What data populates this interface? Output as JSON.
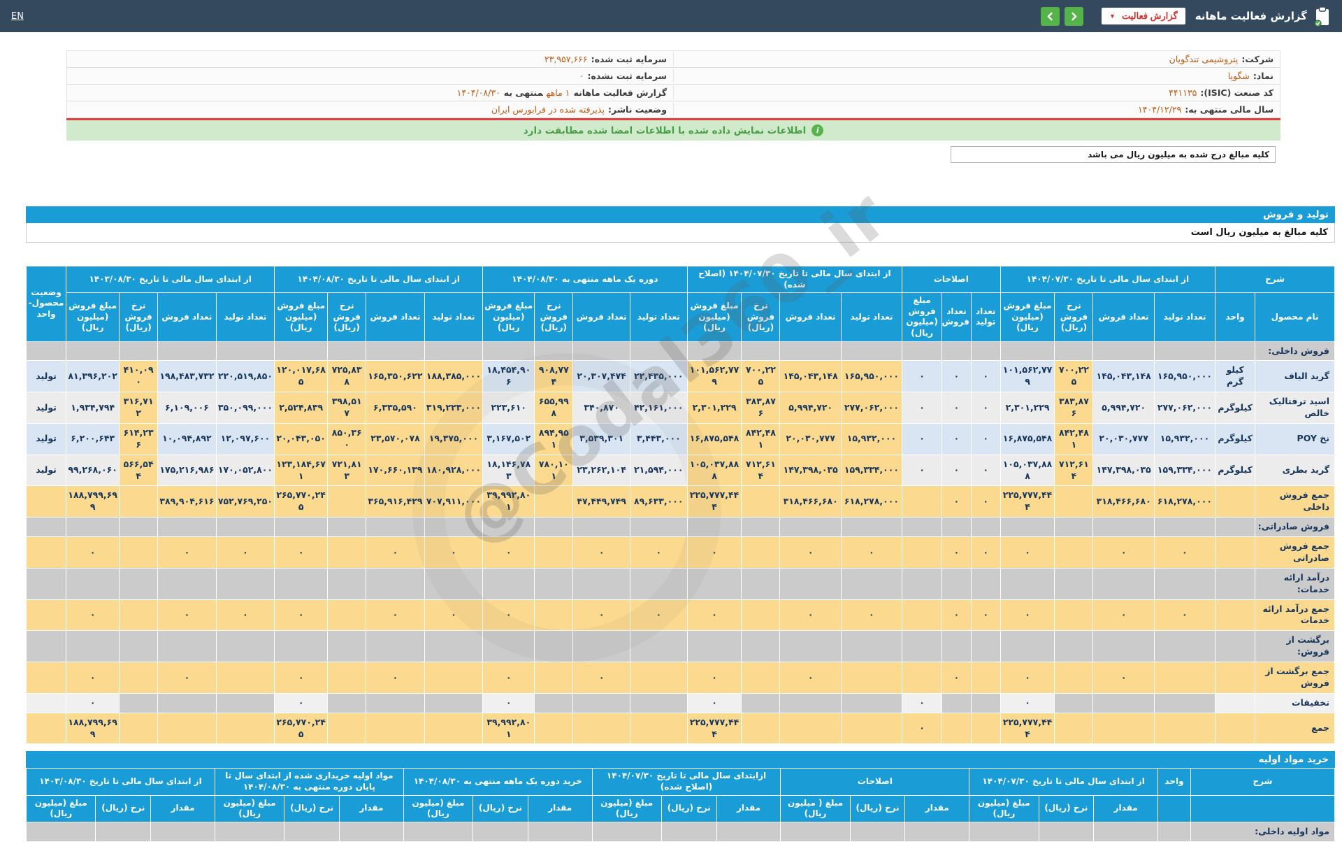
{
  "navbar": {
    "title": "گزارش فعالیت ماهانه",
    "dropdown_label": "گزارش فعالیت",
    "lang": "EN"
  },
  "company_info": {
    "right_rows": [
      {
        "label": "شرکت:",
        "value": "پتروشیمی تندگویان"
      },
      {
        "label": "نماد:",
        "value": "شگویا"
      },
      {
        "label": "کد صنعت (ISIC):",
        "value": "۴۴۱۱۳۵"
      },
      {
        "label": "سال مالی منتهی به:",
        "value": "۱۴۰۴/۱۲/۲۹"
      }
    ],
    "left_rows": [
      {
        "label": "سرمایه ثبت شده:",
        "value": "۲۳,۹۵۷,۶۶۶"
      },
      {
        "label": "سرمایه ثبت نشده:",
        "value": "۰"
      },
      {
        "label": "گزارش فعالیت ماهانه",
        "value": "۱ ماهه",
        "label2": "منتهی به",
        "value2": "۱۴۰۴/۰۸/۳۰"
      },
      {
        "label": "وضعیت ناشر:",
        "value": "پذیرفته شده در فرابورس ایران"
      }
    ]
  },
  "notice": {
    "signed_match": "اطلاعات نمایش داده شده با اطلاعات امضا شده مطابقت دارد",
    "amounts_note": "کلیه مبالغ درج شده به میلیون ریال می باشد"
  },
  "watermark": "@Codal360_ir",
  "production_sales": {
    "section_title": "تولید و فروش",
    "unit_note": "کلیه مبالغ به میلیون ریال است",
    "header_groups": [
      {
        "label": "شرح",
        "cols": [
          "نام محصول",
          "واحد"
        ]
      },
      {
        "label": "از ابتدای سال مالی تا تاریخ ۱۴۰۴/۰۷/۳۰",
        "cols": [
          "تعداد تولید",
          "تعداد فروش",
          "نرخ فروش (ریال)",
          "مبلغ فروش (میلیون ریال)"
        ]
      },
      {
        "label": "اصلاحات",
        "cols": [
          "تعداد تولید",
          "تعداد فروش",
          "مبلغ فروش (میلیون ریال)"
        ]
      },
      {
        "label": "از ابتدای سال مالی تا تاریخ ۱۴۰۴/۰۷/۳۰ (اصلاح شده)",
        "cols": [
          "تعداد تولید",
          "تعداد فروش",
          "نرخ فروش (ریال)",
          "مبلغ فروش (میلیون ریال)"
        ]
      },
      {
        "label": "دوره یک ماهه منتهی به ۱۴۰۴/۰۸/۳۰",
        "cols": [
          "تعداد تولید",
          "تعداد فروش",
          "نرخ فروش (ریال)",
          "مبلغ فروش (میلیون ریال)"
        ]
      },
      {
        "label": "از ابتدای سال مالی تا تاریخ ۱۴۰۴/۰۸/۳۰",
        "cols": [
          "تعداد تولید",
          "تعداد فروش",
          "نرخ فروش (ریال)",
          "مبلغ فروش (میلیون ریال)"
        ]
      },
      {
        "label": "از ابتدای سال مالی تا تاریخ ۱۴۰۳/۰۸/۳۰",
        "cols": [
          "تعداد تولید",
          "تعداد فروش",
          "نرخ فروش (ریال)",
          "مبلغ فروش (میلیون ریال)"
        ]
      },
      {
        "label": "وضعیت محصول- واحد",
        "cols": []
      }
    ],
    "rows": [
      {
        "type": "section",
        "label": "فروش داخلی:"
      },
      {
        "type": "data",
        "name": "گرید الیاف",
        "unit": "کیلو گرم",
        "status": "تولید",
        "cells": [
          "۱۶۵,۹۵۰,۰۰۰",
          "۱۴۵,۰۴۳,۱۴۸",
          "۷۰۰,۲۲۵",
          "۱۰۱,۵۶۲,۷۷۹",
          "۰",
          "۰",
          "۰",
          "۱۶۵,۹۵۰,۰۰۰",
          "۱۴۵,۰۴۳,۱۴۸",
          "۷۰۰,۲۲۵",
          "۱۰۱,۵۶۲,۷۷۹",
          "۲۲,۴۳۵,۰۰۰",
          "۲۰,۳۰۷,۴۷۴",
          "۹۰۸,۷۷۴",
          "۱۸,۴۵۴,۹۰۶",
          "۱۸۸,۳۸۵,۰۰۰",
          "۱۶۵,۳۵۰,۶۲۲",
          "۷۲۵,۸۳۸",
          "۱۲۰,۰۱۷,۶۸۵",
          "۲۲۰,۵۱۹,۸۵۰",
          "۱۹۸,۴۸۳,۷۳۲",
          "۴۱۰,۰۹۰",
          "۸۱,۳۹۶,۲۰۲"
        ]
      },
      {
        "type": "data",
        "name": "اسید ترفتالیک خالص",
        "unit": "کیلوگرم",
        "status": "تولید",
        "cells": [
          "۲۷۷,۰۶۲,۰۰۰",
          "۵,۹۹۴,۷۲۰",
          "۳۸۳,۸۷۶",
          "۲,۳۰۱,۲۲۹",
          "۰",
          "۰",
          "۰",
          "۲۷۷,۰۶۲,۰۰۰",
          "۵,۹۹۴,۷۲۰",
          "۳۸۳,۸۷۶",
          "۲,۳۰۱,۲۲۹",
          "۴۲,۱۶۱,۰۰۰",
          "۳۴۰,۸۷۰",
          "۶۵۵,۹۹۸",
          "۲۲۳,۶۱۰",
          "۳۱۹,۲۲۳,۰۰۰",
          "۶,۳۳۵,۵۹۰",
          "۳۹۸,۵۱۷",
          "۲,۵۲۴,۸۳۹",
          "۳۵۰,۰۹۹,۰۰۰",
          "۶,۱۰۹,۰۰۶",
          "۳۱۶,۷۱۲",
          "۱,۹۳۴,۷۹۴"
        ]
      },
      {
        "type": "data",
        "name": "نخ POY",
        "unit": "کیلوگرم",
        "status": "تولید",
        "cells": [
          "۱۵,۹۳۲,۰۰۰",
          "۲۰,۰۳۰,۷۷۷",
          "۸۴۲,۴۸۱",
          "۱۶,۸۷۵,۵۴۸",
          "۰",
          "۰",
          "۰",
          "۱۵,۹۳۲,۰۰۰",
          "۲۰,۰۳۰,۷۷۷",
          "۸۴۲,۴۸۱",
          "۱۶,۸۷۵,۵۴۸",
          "۳,۴۴۳,۰۰۰",
          "۳,۵۳۹,۳۰۱",
          "۸۹۴,۹۵۱",
          "۳,۱۶۷,۵۰۲",
          "۱۹,۳۷۵,۰۰۰",
          "۲۳,۵۷۰,۰۷۸",
          "۸۵۰,۳۶۰",
          "۲۰,۰۴۳,۰۵۰",
          "۱۲,۰۹۷,۶۰۰",
          "۱۰,۰۹۴,۸۹۲",
          "۶۱۴,۲۳۶",
          "۶,۲۰۰,۶۴۳"
        ]
      },
      {
        "type": "data",
        "name": "گرید بطری",
        "unit": "کیلوگرم",
        "status": "تولید",
        "cells": [
          "۱۵۹,۳۳۴,۰۰۰",
          "۱۴۷,۳۹۸,۰۳۵",
          "۷۱۲,۶۱۴",
          "۱۰۵,۰۳۷,۸۸۸",
          "۰",
          "۰",
          "۰",
          "۱۵۹,۳۳۴,۰۰۰",
          "۱۴۷,۳۹۸,۰۳۵",
          "۷۱۲,۶۱۴",
          "۱۰۵,۰۳۷,۸۸۸",
          "۲۱,۵۹۴,۰۰۰",
          "۲۳,۲۶۲,۱۰۴",
          "۷۸۰,۱۰۱",
          "۱۸,۱۴۶,۷۸۳",
          "۱۸۰,۹۲۸,۰۰۰",
          "۱۷۰,۶۶۰,۱۳۹",
          "۷۲۱,۸۱۳",
          "۱۲۳,۱۸۴,۶۷۱",
          "۱۷۰,۰۵۲,۸۰۰",
          "۱۷۵,۲۱۶,۹۸۶",
          "۵۶۶,۵۴۴",
          "۹۹,۲۶۸,۰۶۰"
        ]
      },
      {
        "type": "total",
        "label": "جمع فروش داخلی",
        "cells": [
          "۶۱۸,۲۷۸,۰۰۰",
          "۳۱۸,۴۶۶,۶۸۰",
          "",
          "۲۲۵,۷۷۷,۴۴۴",
          "۰",
          "۰",
          "",
          "۶۱۸,۲۷۸,۰۰۰",
          "۳۱۸,۴۶۶,۶۸۰",
          "",
          "۲۲۵,۷۷۷,۴۴۴",
          "۸۹,۶۳۳,۰۰۰",
          "۴۷,۴۴۹,۷۴۹",
          "",
          "۳۹,۹۹۲,۸۰۱",
          "۷۰۷,۹۱۱,۰۰۰",
          "۳۶۵,۹۱۶,۴۲۹",
          "",
          "۲۶۵,۷۷۰,۲۴۵",
          "۷۵۲,۷۶۹,۲۵۰",
          "۳۸۹,۹۰۴,۶۱۶",
          "",
          "۱۸۸,۷۹۹,۶۹۹"
        ]
      },
      {
        "type": "section",
        "label": "فروش صادراتی:"
      },
      {
        "type": "total",
        "label": "جمع فروش صادراتی",
        "cells": [
          "۰",
          "۰",
          "",
          "۰",
          "۰",
          "۰",
          "",
          "۰",
          "۰",
          "",
          "۰",
          "۰",
          "۰",
          "",
          "۰",
          "۰",
          "۰",
          "",
          "۰",
          "۰",
          "۰",
          "",
          "۰"
        ]
      },
      {
        "type": "section",
        "label": "درآمد ارائه خدمات:"
      },
      {
        "type": "total",
        "label": "جمع درآمد ارائه خدمات",
        "cells": [
          "۰",
          "۰",
          "",
          "۰",
          "۰",
          "۰",
          "",
          "۰",
          "۰",
          "",
          "۰",
          "۰",
          "۰",
          "",
          "۰",
          "۰",
          "۰",
          "",
          "۰",
          "۰",
          "۰",
          "",
          "۰"
        ]
      },
      {
        "type": "section",
        "label": "برگشت از فروش:"
      },
      {
        "type": "total",
        "label": "جمع برگشت از فروش",
        "cells": [
          "",
          "۰",
          "",
          "۰",
          "",
          "۰",
          "",
          "",
          "۰",
          "",
          "۰",
          "",
          "۰",
          "",
          "۰",
          "",
          "۰",
          "",
          "۰",
          "",
          "۰",
          "",
          "۰"
        ]
      },
      {
        "type": "discount",
        "label": "تخفیفات",
        "cells": [
          "",
          "",
          "",
          "۰",
          "",
          "",
          "۰",
          "",
          "",
          "",
          "۰",
          "",
          "",
          "",
          "۰",
          "",
          "",
          "",
          "۰",
          "",
          "",
          "",
          "۰"
        ]
      },
      {
        "type": "total",
        "label": "جمع",
        "cells": [
          "",
          "",
          "",
          "۲۲۵,۷۷۷,۴۴۴",
          "",
          "",
          "۰",
          "",
          "",
          "",
          "۲۲۵,۷۷۷,۴۴۴",
          "",
          "",
          "",
          "۳۹,۹۹۲,۸۰۱",
          "",
          "",
          "",
          "۲۶۵,۷۷۰,۲۴۵",
          "",
          "",
          "",
          "۱۸۸,۷۹۹,۶۹۹"
        ]
      }
    ]
  },
  "raw_materials": {
    "section_title": "خرید مواد اولیه",
    "header_groups": [
      {
        "label": "شرح",
        "cols": [
          ""
        ]
      },
      {
        "label": "واحد",
        "cols": [
          ""
        ]
      },
      {
        "label": "از ابتدای سال مالی تا تاریخ ۱۴۰۴/۰۷/۳۰",
        "cols": [
          "مقدار",
          "نرخ (ریال)",
          "مبلغ (میلیون ریال)"
        ]
      },
      {
        "label": "اصلاحات",
        "cols": [
          "مقدار",
          "نرخ (ریال)",
          "مبلغ ( میلیون ریال)"
        ]
      },
      {
        "label": "ازابتدای سال مالی تا تاریخ ۱۴۰۴/۰۷/۳۰ (اصلاح شده)",
        "cols": [
          "مقدار",
          "نرخ (ریال)",
          "مبلغ (میلیون ریال)"
        ]
      },
      {
        "label": "خرید دوره یک ماهه منتهی به ۱۴۰۴/۰۸/۳۰",
        "cols": [
          "مقدار",
          "نرخ (ریال)",
          "مبلغ (میلیون ریال)"
        ]
      },
      {
        "label": "مواد اولیه خریداری شده از ابتدای سال تا پایان دوره منتهی به ۱۴۰۴/۰۸/۳۰",
        "cols": [
          "مقدار",
          "نرخ (ریال)",
          "مبلغ (میلیون ریال)"
        ]
      },
      {
        "label": "از ابتدای سال مالی تا تاریخ ۱۴۰۳/۰۸/۳۰",
        "cols": [
          "مقدار",
          "نرخ (ریال)",
          "مبلغ (میلیون ریال)"
        ]
      }
    ],
    "partial_row_label": "مواد اولیه داخلی:"
  }
}
